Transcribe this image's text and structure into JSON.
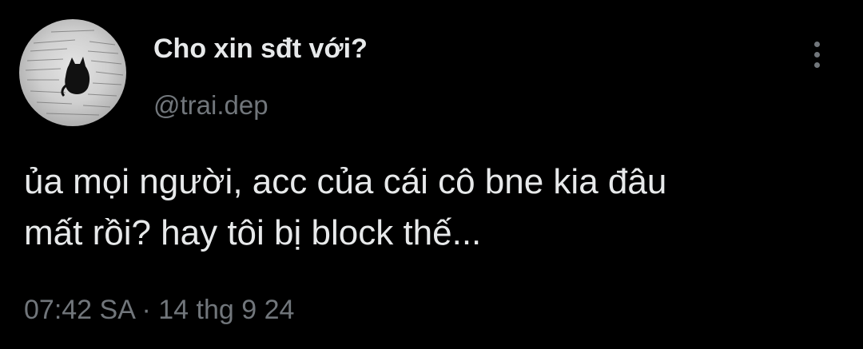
{
  "tweet": {
    "author": {
      "display_name": "Cho xin sđt với?",
      "handle": "@trai.dep",
      "avatar_icon": "cat-on-paper-avatar"
    },
    "more_icon": "more-vertical-icon",
    "text_lines": [
      "ủa mọi người, acc của cái cô bne kia đâu",
      "mất rồi? hay tôi bị block thế..."
    ],
    "time": "07:42 SA",
    "separator": "·",
    "date": "14 thg 9 24"
  },
  "colors": {
    "background": "#000000",
    "primary_text": "#e7e9ea",
    "secondary_text": "#71767b"
  }
}
